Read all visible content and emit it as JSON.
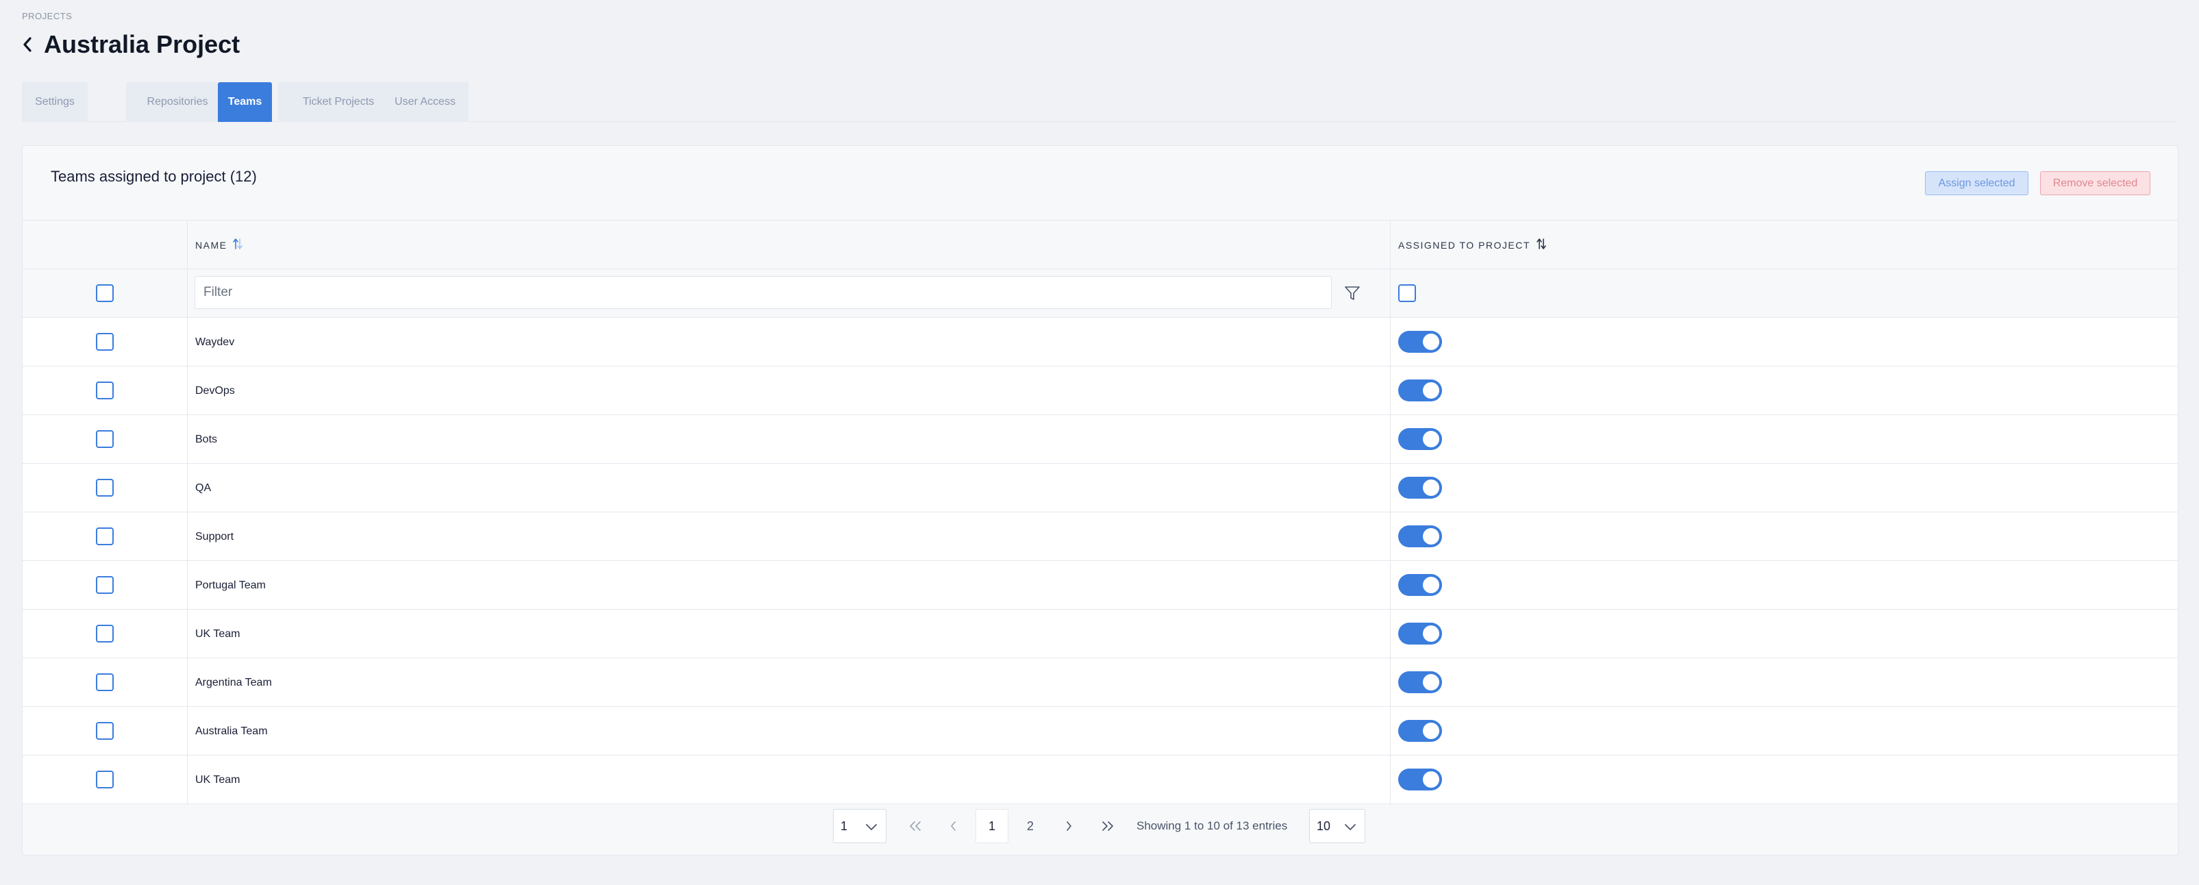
{
  "breadcrumb": "PROJECTS",
  "title": "Australia Project",
  "tabs": [
    {
      "label": "Settings"
    },
    {
      "label": "Repositories"
    },
    {
      "label": "Teams"
    },
    {
      "label": "Ticket Projects"
    },
    {
      "label": "User Access"
    }
  ],
  "active_tab": "Teams",
  "card": {
    "title": "Teams assigned to project (12)",
    "assign_label": "Assign selected",
    "remove_label": "Remove selected"
  },
  "table": {
    "columns": {
      "name": "NAME",
      "assigned": "ASSIGNED TO PROJECT"
    },
    "filter_placeholder": "Filter",
    "filter_value": "",
    "rows": [
      {
        "name": "Waydev",
        "assigned": true,
        "selected": false
      },
      {
        "name": "DevOps",
        "assigned": true,
        "selected": false
      },
      {
        "name": "Bots",
        "assigned": true,
        "selected": false
      },
      {
        "name": "QA",
        "assigned": true,
        "selected": false
      },
      {
        "name": "Support",
        "assigned": true,
        "selected": false
      },
      {
        "name": "Portugal Team",
        "assigned": true,
        "selected": false
      },
      {
        "name": "UK Team",
        "assigned": true,
        "selected": false
      },
      {
        "name": "Argentina Team",
        "assigned": true,
        "selected": false
      },
      {
        "name": "Australia Team",
        "assigned": true,
        "selected": false
      },
      {
        "name": "UK Team",
        "assigned": true,
        "selected": false
      }
    ]
  },
  "pagination": {
    "page_select": "1",
    "pages": [
      "1",
      "2"
    ],
    "current_page": "1",
    "info": "Showing 1 to 10 of 13 entries",
    "page_size": "10"
  },
  "colors": {
    "accent": "#3b7ddd",
    "assign_bg": "#d6e4fb",
    "remove_bg": "#fbe1e4"
  },
  "icons": {
    "back": "chevron-left-icon",
    "sort": "sort-icon",
    "filter": "filter-icon",
    "first": "double-chevron-left-icon",
    "prev": "chevron-left-icon",
    "next": "chevron-right-icon",
    "last": "double-chevron-right-icon",
    "dropdown": "chevron-down-icon"
  }
}
